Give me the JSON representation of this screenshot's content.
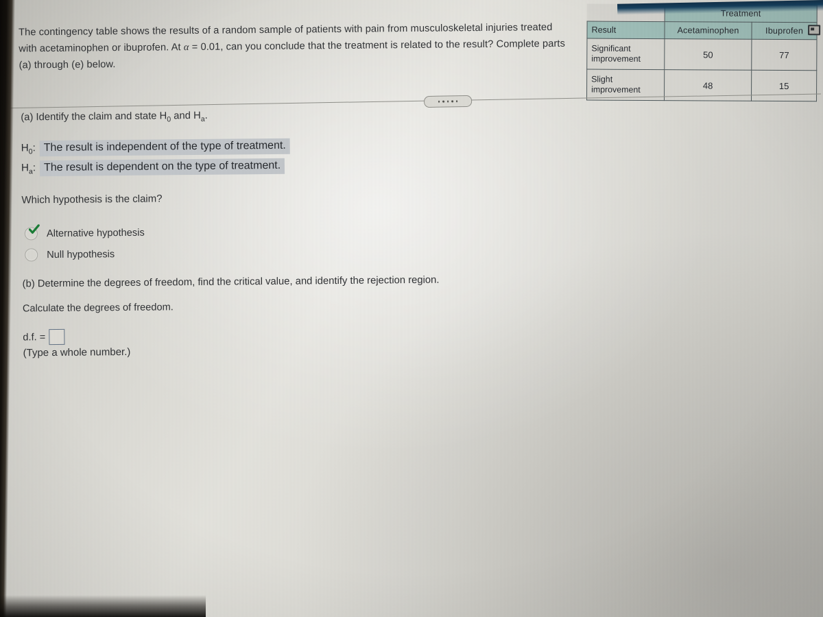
{
  "question": {
    "intro_part1": "The contingency table shows the results of a random sample of patients with pain from musculoskeletal injuries treated with acetaminophen or ibuprofen. At ",
    "alpha_symbol": "α",
    "intro_part2": " = 0.01, can you conclude that the treatment is related to the result? Complete parts (a) through (e) below."
  },
  "contingency_table": {
    "group_header": "Treatment",
    "result_header": "Result",
    "columns": [
      "Acetaminophen",
      "Ibuprofen"
    ],
    "rows": [
      {
        "label_line1": "Significant",
        "label_line2": "improvement",
        "values": [
          "50",
          "77"
        ]
      },
      {
        "label_line1": "Slight",
        "label_line2": "improvement",
        "values": [
          "48",
          "15"
        ]
      }
    ],
    "popout_icon": "popout-icon"
  },
  "divider": {
    "handle_icon": "drag-dots-icon",
    "dot_count": 5
  },
  "part_a": {
    "prompt_prefix": "(a) Identify the claim and state H",
    "prompt_sub0": "0",
    "prompt_mid": " and H",
    "prompt_suba": "a",
    "prompt_suffix": ".",
    "h0_label_main": "H",
    "h0_label_sub": "0",
    "h0_colon": ":",
    "h0_text": "The result is independent of the type of treatment.",
    "ha_label_main": "H",
    "ha_label_sub": "a",
    "ha_colon": ":",
    "ha_text": "The result is dependent on the type of treatment.",
    "which_question": "Which hypothesis is the claim?",
    "choices": [
      {
        "label": "Alternative hypothesis",
        "selected": true,
        "marker": "green-check-icon"
      },
      {
        "label": "Null hypothesis",
        "selected": false,
        "marker": "radio-empty-icon"
      }
    ]
  },
  "part_b": {
    "prompt": "(b) Determine the degrees of freedom, find the critical value, and identify the rejection region.",
    "calculate_line": "Calculate the degrees of freedom.",
    "df_label": "d.f. =",
    "df_value": "",
    "df_placeholder": "",
    "type_note": "(Type a whole number.)"
  },
  "colors": {
    "table_header_fill": "#9dbdb7",
    "table_cell_fill": "#d7d6d0",
    "table_border": "#4a5558",
    "highlight_fill": "#c2c6ca",
    "check_green": "#157a32",
    "input_border": "#5f6f82",
    "page_background": "#dcdbd5",
    "bezel": "#12100d",
    "top_band": "#16405e"
  }
}
